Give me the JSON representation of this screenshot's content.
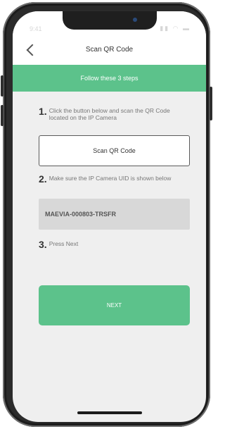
{
  "status_bar": {
    "time": "9:41",
    "icons": "▮▮ ◠ ▬"
  },
  "nav": {
    "title": "Scan QR Code"
  },
  "banner": {
    "text": "Follow these 3 steps"
  },
  "steps": [
    {
      "num": "1.",
      "text": "Click the button below and scan the QR Code located on the IP Camera"
    },
    {
      "num": "2.",
      "text": "Make sure the IP Camera UID is shown below"
    },
    {
      "num": "3.",
      "text": "Press Next"
    }
  ],
  "scan_button": {
    "label": "Scan QR Code"
  },
  "uid": {
    "value": "MAEVIA-000803-TRSFR"
  },
  "next_button": {
    "label": "NEXT"
  },
  "colors": {
    "accent": "#5cc28b",
    "background": "#efefef",
    "uid_box": "#d8d8d8"
  },
  "icons": {
    "back": "chevron-left-icon"
  }
}
